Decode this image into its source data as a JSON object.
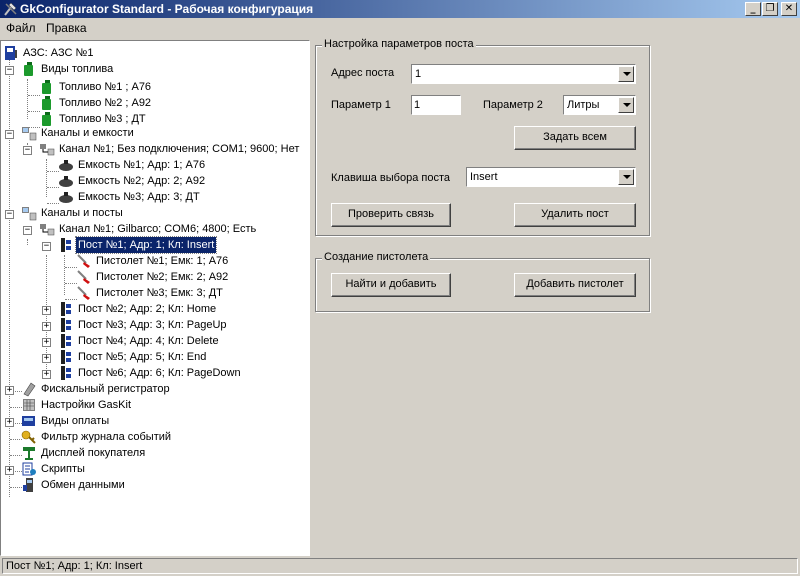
{
  "window": {
    "title": "GkConfigurator Standard - Рабочая конфигурация",
    "minimize": "_",
    "maximize": "❐",
    "close": "✕"
  },
  "menu": [
    {
      "label": "Файл"
    },
    {
      "label": "Правка"
    }
  ],
  "tree": {
    "root": "АЗС: АЗС №1",
    "fuel_types": {
      "label": "Виды топлива",
      "items": [
        "Топливо №1 ; А76",
        "Топливо №2 ; А92",
        "Топливо №3 ; ДТ"
      ]
    },
    "channels_tanks": {
      "label": "Каналы и емкости",
      "channel": "Канал №1; Без подключения; COM1; 9600; Нет",
      "tanks": [
        "Емкость №1; Адр: 1; А76",
        "Емкость №2; Адр: 2; А92",
        "Емкость №3; Адр: 3; ДТ"
      ]
    },
    "channels_posts": {
      "label": "Каналы и посты",
      "channel": "Канал №1; Gilbarco; COM6; 4800; Есть",
      "selected_post": "Пост №1; Адр: 1; Кл: Insert",
      "pistols": [
        "Пистолет №1; Емк: 1; А76",
        "Пистолет №2; Емк: 2; А92",
        "Пистолет №3; Емк: 3; ДТ"
      ],
      "posts": [
        "Пост №2; Адр: 2; Кл: Home",
        "Пост №3; Адр: 3; Кл: PageUp",
        "Пост №4; Адр: 4; Кл: Delete",
        "Пост №5; Адр: 5; Кл: End",
        "Пост №6; Адр: 6; Кл: PageDown"
      ]
    },
    "other": [
      "Фискальный регистратор",
      "Настройки GasKit",
      "Виды оплаты",
      "Фильтр журнала событий",
      "Дисплей покупателя",
      "Скрипты",
      "Обмен данными"
    ]
  },
  "post_settings": {
    "title": "Настройка параметров поста",
    "address_label": "Адрес поста",
    "address_value": "1",
    "param1_label": "Параметр 1",
    "param1_value": "1",
    "param2_label": "Параметр 2",
    "param2_value": "Литры",
    "set_all_button": "Задать всем",
    "key_label": "Клавиша выбора поста",
    "key_value": "Insert",
    "check_button": "Проверить связь",
    "delete_button": "Удалить пост"
  },
  "pistol_create": {
    "title": "Создание пистолета",
    "find_add_button": "Найти и добавить",
    "add_pistol_button": "Добавить пистолет"
  },
  "status": {
    "text": "Пост №1; Адр: 1; Кл: Insert"
  }
}
